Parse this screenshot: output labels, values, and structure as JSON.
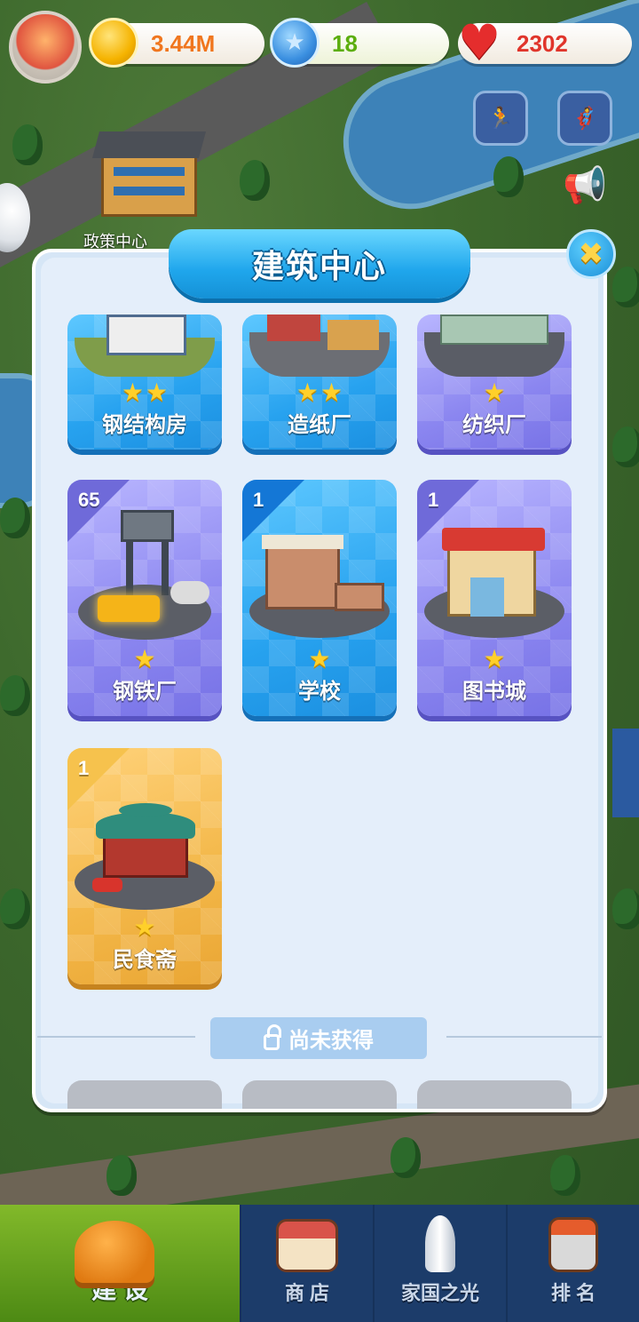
{
  "hud": {
    "coins": "3.44M",
    "gems": "18",
    "hearts": "2302"
  },
  "map": {
    "building_label": "政策中心"
  },
  "panel": {
    "title": "建筑中心",
    "close_symbol": "✖",
    "locked_label": "尚未获得"
  },
  "cards": [
    {
      "name": "钢结构房",
      "stars": 2,
      "color": "blue",
      "count": ""
    },
    {
      "name": "造纸厂",
      "stars": 2,
      "color": "blue",
      "count": ""
    },
    {
      "name": "纺织厂",
      "stars": 1,
      "color": "purple",
      "count": ""
    },
    {
      "name": "钢铁厂",
      "stars": 1,
      "color": "purple",
      "count": "65"
    },
    {
      "name": "学校",
      "stars": 1,
      "color": "blue",
      "count": "1"
    },
    {
      "name": "图书城",
      "stars": 1,
      "color": "purple",
      "count": "1"
    },
    {
      "name": "民食斋",
      "stars": 1,
      "color": "gold",
      "count": "1"
    }
  ],
  "nav": {
    "build": "建 设",
    "shop": "商 店",
    "glory": "家国之光",
    "rank": "排 名"
  },
  "colors": {
    "coin_text": "#f0761e",
    "gem_text": "#5cae0e",
    "heart_text": "#e0352b",
    "panel_bg": "#e4eefa",
    "title_banner": "#1fa6ec",
    "nav_bg": "#1c3c6a",
    "nav_active": "#6ea61f"
  },
  "icons": {
    "avatar": "anime-girl-avatar",
    "coin": "gold-coin-icon",
    "gem": "blue-star-gem-icon",
    "heart": "red-heart-icon",
    "event1": "running-people-icon",
    "event2": "superhero-icon",
    "announce": "megaphone-icon",
    "close": "close-icon",
    "lock": "lock-icon",
    "build": "hard-hat-icon",
    "shop": "shop-building-icon",
    "glory": "rocket-icon",
    "rank": "podium-building-icon"
  }
}
